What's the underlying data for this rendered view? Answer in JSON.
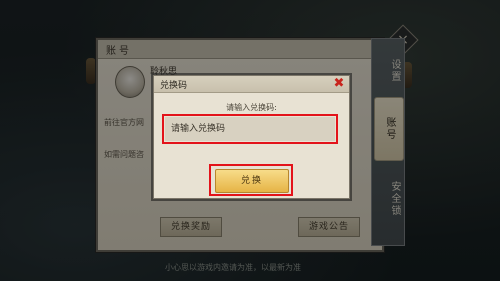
{
  "panel": {
    "title": "账号",
    "player_name": "聆秋思",
    "side_texts": [
      "前往官方网",
      "如需问题咨"
    ],
    "buttons": [
      "兑换奖励",
      "游戏公告"
    ]
  },
  "tabs": [
    "设置",
    "账号",
    "安全锁"
  ],
  "active_tab": "账号",
  "dialog": {
    "title": "兑换码",
    "close_symbol": "✖",
    "prompt": "请输入兑换码:",
    "input_placeholder": "请输入兑换码",
    "confirm_label": "兑换"
  },
  "background_text": "小心思以游戏内邀请为准，以最新为准",
  "icons": {
    "close": "close-icon",
    "corner": "corner-close-icon"
  },
  "colors": {
    "highlight": "#e3131a",
    "confirm_button": "#e6b446",
    "panel_bg": "#e8e2d3"
  }
}
